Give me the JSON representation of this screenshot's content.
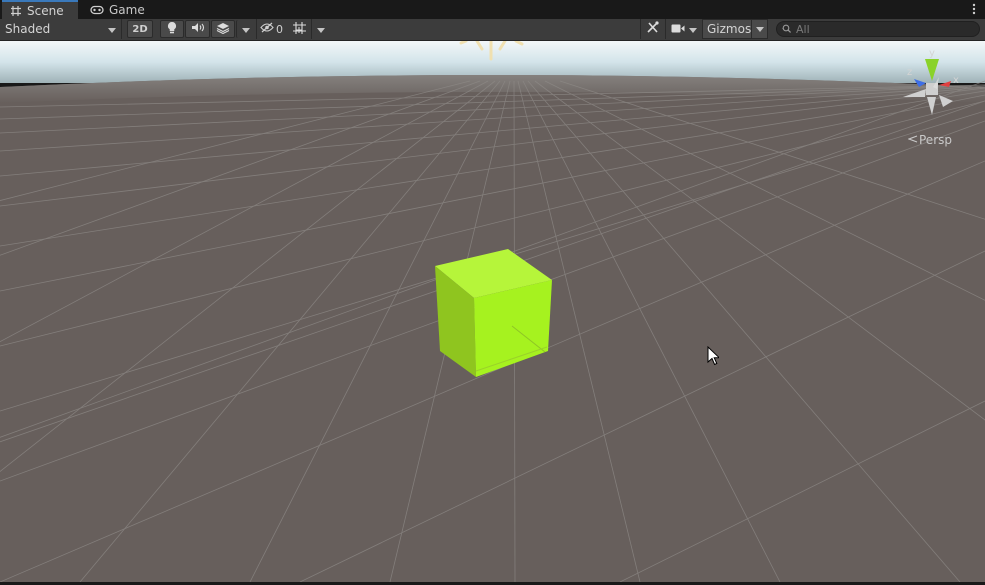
{
  "tabs": [
    {
      "label": "Scene",
      "icon": "grid-icon",
      "active": true
    },
    {
      "label": "Game",
      "icon": "gamepad-icon",
      "active": false
    }
  ],
  "toolbar": {
    "shading_mode": "Shaded",
    "mode_2d_label": "2D",
    "hidden_count": "0",
    "gizmos_label": "Gizmos",
    "search_placeholder": "All"
  },
  "scene": {
    "projection_label": "Persp",
    "axis_labels": {
      "y": "y",
      "x": "x",
      "z": "z"
    },
    "cube_color": "#a6f21f",
    "sky_color": "#dbe9ee",
    "ground_color": "#675f5c"
  },
  "colors": {
    "accent": "#3a79bb",
    "toolbar_bg": "#3c3c3c",
    "x_axis": "#e04040",
    "y_axis": "#8ad22a",
    "z_axis": "#3d6ee6"
  }
}
